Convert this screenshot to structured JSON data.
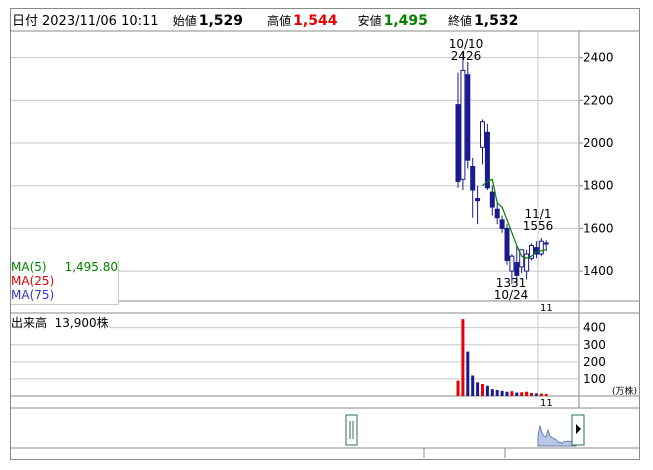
{
  "header": {
    "title": "日付",
    "datetime": "2023/11/06 10:11",
    "open_label": "始値",
    "open_value": "1,529",
    "high_label": "高値",
    "high_value": "1,544",
    "low_label": "安値",
    "low_value": "1,495",
    "close_label": "終値",
    "close_value": "1,532",
    "colors": {
      "high": "#e60000",
      "low": "#008000",
      "neutral": "#000000"
    }
  },
  "legend": {
    "ma5_label": "MA(5)",
    "ma5_value": "1,495.80",
    "ma5_color": "#008000",
    "ma25_label": "MA(25)",
    "ma25_color": "#e60000",
    "ma75_label": "MA(75)",
    "ma75_color": "#3333cc"
  },
  "volume_legend": {
    "label": "出来高",
    "value": "13,900株"
  },
  "colors": {
    "up": "#ffffff",
    "down": "#1a1a8c",
    "candle_edge": "#1a1a8c",
    "vol_up": "#e60000",
    "vol_down": "#1a1a8c",
    "grid": "#c8c8c8",
    "nav_fill": "#b8c8e8",
    "nav_line": "#6f7fb0"
  },
  "chart_data": [
    {
      "type": "candlestick",
      "yticks": [
        1400,
        1600,
        1800,
        2000,
        2200,
        2400
      ],
      "ylim": [
        1260,
        2520
      ],
      "x_tick_label": "11",
      "annotations": {
        "high": {
          "value": 2426,
          "value_label": "2426",
          "date_label": "10/10"
        },
        "low": {
          "value": 1331,
          "value_label": "1331",
          "date_label": "10/24"
        },
        "recent_high": {
          "value": 1556,
          "value_label": "1556",
          "date_label": "11/1"
        }
      },
      "candles": [
        {
          "o": 2180,
          "h": 2330,
          "l": 1790,
          "c": 1820
        },
        {
          "o": 1830,
          "h": 2426,
          "l": 1780,
          "c": 2340
        },
        {
          "o": 2320,
          "h": 2380,
          "l": 1880,
          "c": 1920
        },
        {
          "o": 1890,
          "h": 1930,
          "l": 1650,
          "c": 1780
        },
        {
          "o": 1740,
          "h": 1800,
          "l": 1620,
          "c": 1730
        },
        {
          "o": 1980,
          "h": 2110,
          "l": 1900,
          "c": 2100
        },
        {
          "o": 2050,
          "h": 2090,
          "l": 1780,
          "c": 1790
        },
        {
          "o": 1770,
          "h": 1800,
          "l": 1660,
          "c": 1700
        },
        {
          "o": 1690,
          "h": 1720,
          "l": 1620,
          "c": 1650
        },
        {
          "o": 1640,
          "h": 1660,
          "l": 1580,
          "c": 1600
        },
        {
          "o": 1600,
          "h": 1620,
          "l": 1430,
          "c": 1450
        },
        {
          "o": 1400,
          "h": 1480,
          "l": 1340,
          "c": 1470
        },
        {
          "o": 1440,
          "h": 1520,
          "l": 1331,
          "c": 1380
        },
        {
          "o": 1420,
          "h": 1500,
          "l": 1390,
          "c": 1500
        },
        {
          "o": 1400,
          "h": 1500,
          "l": 1360,
          "c": 1480
        },
        {
          "o": 1460,
          "h": 1530,
          "l": 1450,
          "c": 1520
        },
        {
          "o": 1510,
          "h": 1540,
          "l": 1460,
          "c": 1480
        },
        {
          "o": 1480,
          "h": 1556,
          "l": 1470,
          "c": 1540
        },
        {
          "o": 1529,
          "h": 1544,
          "l": 1495,
          "c": 1532
        }
      ],
      "ma5": [
        null,
        null,
        null,
        null,
        null,
        1800,
        1820,
        1830,
        1720,
        1700,
        1640,
        1580,
        1520,
        1470,
        1460,
        1470,
        1490,
        1495.8,
        1500
      ]
    },
    {
      "type": "bar",
      "title": "出来高",
      "yticks": [
        100,
        200,
        300,
        400
      ],
      "ylim": [
        0,
        480
      ],
      "unit": "(万株)",
      "x_tick_label": "11",
      "values": [
        90,
        450,
        260,
        120,
        80,
        70,
        60,
        40,
        35,
        30,
        25,
        28,
        20,
        22,
        25,
        18,
        15,
        14,
        12
      ],
      "up": [
        true,
        true,
        false,
        false,
        false,
        true,
        false,
        false,
        false,
        false,
        false,
        true,
        false,
        true,
        true,
        true,
        false,
        true,
        true
      ]
    }
  ]
}
